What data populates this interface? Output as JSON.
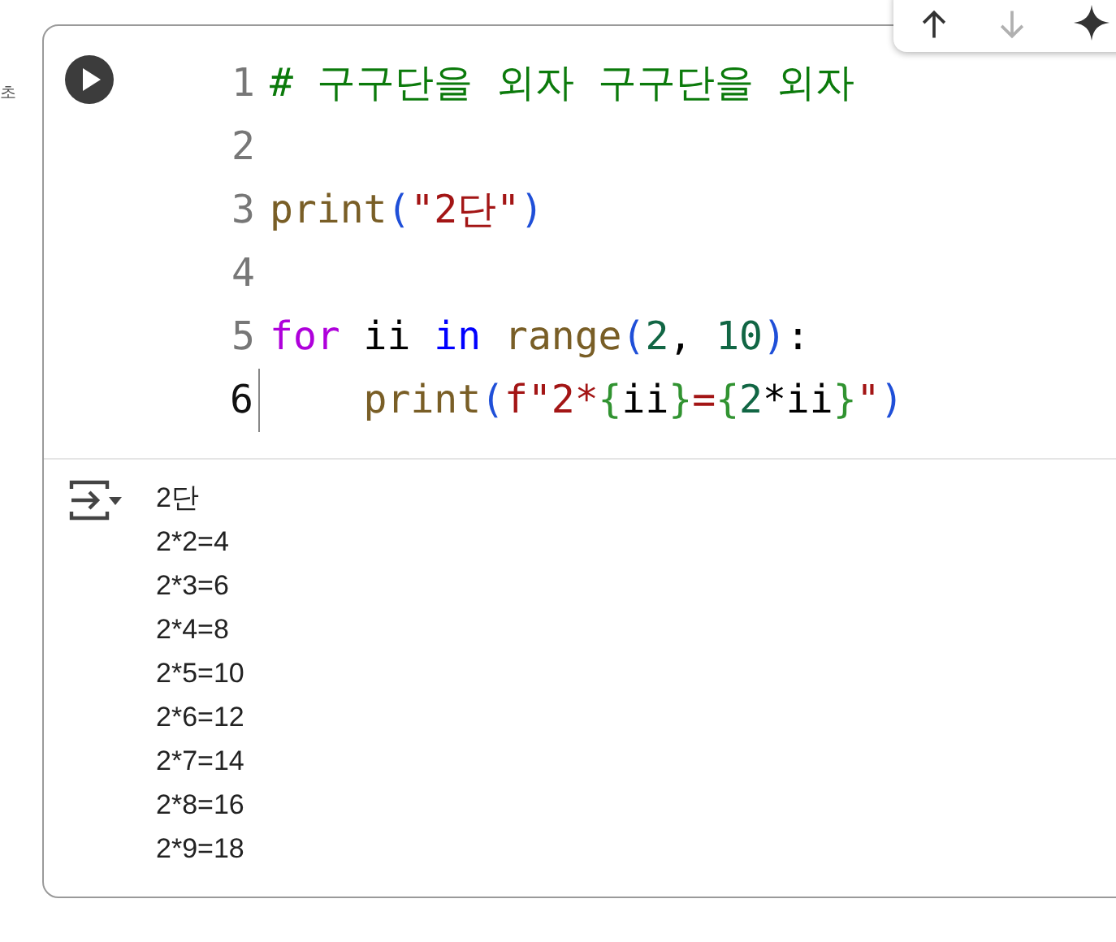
{
  "side_label": "초",
  "code_lines": [
    {
      "number": "1",
      "current": false,
      "tokens": [
        {
          "text": "# 구구단을 외자 구구단을 외자",
          "kind": "comment"
        }
      ]
    },
    {
      "number": "2",
      "current": false
    },
    {
      "number": "3",
      "current": false,
      "tokens": [
        {
          "text": "print",
          "kind": "func"
        },
        {
          "text": "(",
          "kind": "paren"
        },
        {
          "text": "\"2단\"",
          "kind": "string"
        },
        {
          "text": ")",
          "kind": "paren"
        }
      ]
    },
    {
      "number": "4",
      "current": false
    },
    {
      "number": "5",
      "current": false,
      "tokens": [
        {
          "text": "for",
          "kind": "keyword"
        },
        {
          "text": " ii ",
          "kind": "plain"
        },
        {
          "text": "in",
          "kind": "operator"
        },
        {
          "text": " range",
          "kind": "func"
        },
        {
          "text": "(",
          "kind": "paren"
        },
        {
          "text": "2",
          "kind": "number"
        },
        {
          "text": ", ",
          "kind": "plain"
        },
        {
          "text": "10",
          "kind": "number"
        },
        {
          "text": ")",
          "kind": "paren"
        },
        {
          "text": ":",
          "kind": "plain"
        }
      ]
    },
    {
      "number": "6",
      "current": true,
      "tokens": [
        {
          "text": "    print",
          "kind": "func"
        },
        {
          "text": "(",
          "kind": "paren"
        },
        {
          "text": "f\"2*",
          "kind": "string"
        },
        {
          "text": "{",
          "kind": "brace"
        },
        {
          "text": "ii",
          "kind": "plain"
        },
        {
          "text": "}",
          "kind": "brace"
        },
        {
          "text": "=",
          "kind": "string"
        },
        {
          "text": "{",
          "kind": "brace"
        },
        {
          "text": "2",
          "kind": "number"
        },
        {
          "text": "*ii",
          "kind": "plain"
        },
        {
          "text": "}",
          "kind": "brace"
        },
        {
          "text": "\"",
          "kind": "string"
        },
        {
          "text": ")",
          "kind": "paren"
        }
      ]
    }
  ],
  "output_lines": [
    "2단",
    "2*2=4",
    "2*3=6",
    "2*4=8",
    "2*5=10",
    "2*6=12",
    "2*7=14",
    "2*8=16",
    "2*9=18"
  ],
  "toolbar": [
    {
      "kind": "up",
      "disabled": false
    },
    {
      "kind": "down",
      "disabled": true
    },
    {
      "kind": "sparkle",
      "disabled": false
    }
  ]
}
